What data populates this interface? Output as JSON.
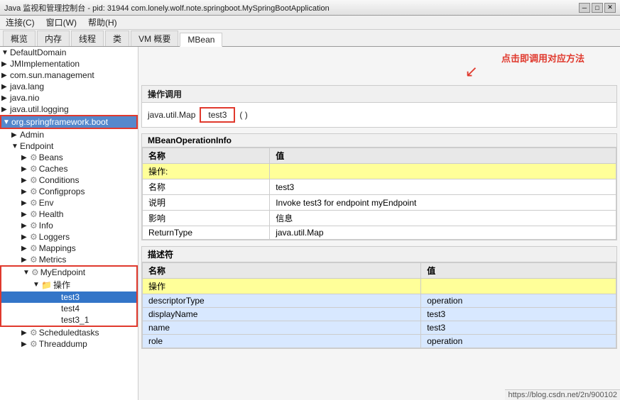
{
  "titleBar": {
    "title": "Java 监视和管理控制台 - pid: 31944 com.lonely.wolf.note.springboot.MySpringBootApplication",
    "minBtn": "─",
    "maxBtn": "□",
    "closeBtn": "✕"
  },
  "menuBar": {
    "items": [
      "连接(C)",
      "窗口(W)",
      "帮助(H)"
    ]
  },
  "tabs": {
    "items": [
      "概览",
      "内存",
      "线程",
      "类",
      "VM 概要",
      "MBean"
    ],
    "activeIndex": 5
  },
  "sidebar": {
    "items": [
      {
        "id": "defaultdomain",
        "label": "DefaultDomain",
        "level": 0,
        "type": "expand",
        "expanded": true
      },
      {
        "id": "jmimpl",
        "label": "JMImplementation",
        "level": 0,
        "type": "expand",
        "expanded": false
      },
      {
        "id": "comsun",
        "label": "com.sun.management",
        "level": 0,
        "type": "expand",
        "expanded": false
      },
      {
        "id": "javalang",
        "label": "java.lang",
        "level": 0,
        "type": "expand",
        "expanded": false
      },
      {
        "id": "javanio",
        "label": "java.nio",
        "level": 0,
        "type": "expand",
        "expanded": false
      },
      {
        "id": "javalogging",
        "label": "java.util.logging",
        "level": 0,
        "type": "expand",
        "expanded": false
      },
      {
        "id": "springframework",
        "label": "org.springframework.boot",
        "level": 0,
        "type": "expand",
        "expanded": true,
        "highlighted": true
      },
      {
        "id": "admin",
        "label": "Admin",
        "level": 1,
        "type": "expand",
        "expanded": false
      },
      {
        "id": "endpoint",
        "label": "Endpoint",
        "level": 1,
        "type": "expand",
        "expanded": true
      },
      {
        "id": "beans",
        "label": "Beans",
        "level": 2,
        "type": "gear",
        "expanded": false
      },
      {
        "id": "caches",
        "label": "Caches",
        "level": 2,
        "type": "gear",
        "expanded": false
      },
      {
        "id": "conditions",
        "label": "Conditions",
        "level": 2,
        "type": "gear",
        "expanded": false
      },
      {
        "id": "configprops",
        "label": "Configprops",
        "level": 2,
        "type": "gear",
        "expanded": false
      },
      {
        "id": "env",
        "label": "Env",
        "level": 2,
        "type": "gear",
        "expanded": false
      },
      {
        "id": "health",
        "label": "Health",
        "level": 2,
        "type": "gear",
        "expanded": false
      },
      {
        "id": "info",
        "label": "Info",
        "level": 2,
        "type": "gear",
        "expanded": false
      },
      {
        "id": "loggers",
        "label": "Loggers",
        "level": 2,
        "type": "gear",
        "expanded": false
      },
      {
        "id": "mappings",
        "label": "Mappings",
        "level": 2,
        "type": "gear",
        "expanded": false
      },
      {
        "id": "metrics",
        "label": "Metrics",
        "level": 2,
        "type": "gear",
        "expanded": false
      },
      {
        "id": "myendpoint",
        "label": "MyEndpoint",
        "level": 2,
        "type": "gear",
        "expanded": true,
        "borderHighlight": true
      },
      {
        "id": "caozuo",
        "label": "操作",
        "level": 3,
        "type": "folder",
        "expanded": true
      },
      {
        "id": "test3",
        "label": "test3",
        "level": 4,
        "type": "leaf",
        "selected": true
      },
      {
        "id": "test4",
        "label": "test4",
        "level": 4,
        "type": "leaf"
      },
      {
        "id": "test3_1",
        "label": "test3_1",
        "level": 4,
        "type": "leaf"
      },
      {
        "id": "scheduledtasks",
        "label": "Scheduledtasks",
        "level": 2,
        "type": "gear",
        "expanded": false
      },
      {
        "id": "threaddump",
        "label": "Threaddump",
        "level": 2,
        "type": "gear",
        "expanded": false
      }
    ]
  },
  "content": {
    "annotation": {
      "text": "点击即调用对应方法",
      "arrowChar": "↙"
    },
    "operationSection": {
      "title": "操作调用",
      "javaType": "java.util.Map",
      "methodName": "test3",
      "params": "( )"
    },
    "mbeanInfo": {
      "title": "MBeanOperationInfo",
      "headers": [
        "名称",
        "值"
      ],
      "rows": [
        {
          "name": "操作:",
          "value": "",
          "style": "yellow"
        },
        {
          "name": "名称",
          "value": "test3",
          "style": "white"
        },
        {
          "name": "说明",
          "value": "Invoke test3 for endpoint myEndpoint",
          "style": "white"
        },
        {
          "name": "影响",
          "value": "信息",
          "style": "white"
        },
        {
          "name": "ReturnType",
          "value": "java.util.Map",
          "style": "white"
        }
      ]
    },
    "descriptorSection": {
      "title": "描述符",
      "headers": [
        "名称",
        "值"
      ],
      "rows": [
        {
          "name": "操作",
          "value": "",
          "style": "yellow"
        },
        {
          "name": "descriptorType",
          "value": "operation",
          "style": "blue"
        },
        {
          "name": "displayName",
          "value": "test3",
          "style": "blue"
        },
        {
          "name": "name",
          "value": "test3",
          "style": "blue"
        },
        {
          "name": "role",
          "value": "operation",
          "style": "blue"
        }
      ]
    }
  },
  "statusBar": {
    "url": "https://blog.csdn.net/2n/900102"
  }
}
